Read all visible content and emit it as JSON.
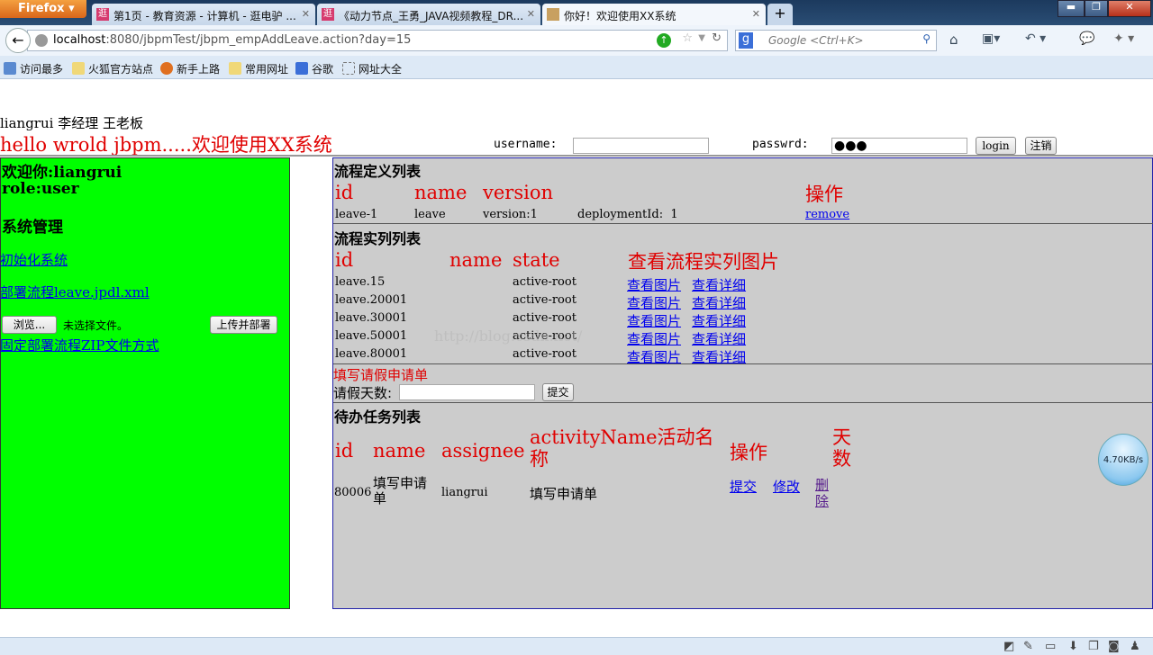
{
  "browser": {
    "menu_label": "Firefox",
    "tabs": [
      {
        "title": "第1页 - 教育资源 - 计算机 - 逛电驴 ...",
        "favicon": "逛"
      },
      {
        "title": "《动力节点_王勇_JAVA视频教程_DR...",
        "favicon": "逛"
      },
      {
        "title": "你好！欢迎使用XX系统",
        "active": true
      }
    ],
    "url_host": "localhost",
    "url_rest": ":8080/jbpmTest/jbpm_empAddLeave.action?day=15",
    "search_placeholder": "Google <Ctrl+K>",
    "bookmarks": [
      "访问最多",
      "火狐官方站点",
      "新手上路",
      "常用网址",
      "谷歌",
      "网址大全"
    ],
    "speed_badge": "4.70KB/s"
  },
  "header": {
    "users": "liangrui 李经理 王老板",
    "title": "hello wrold jbpm.....欢迎使用XX系统",
    "username_label": "username:",
    "username_value": "",
    "password_label": "passwrd:",
    "password_value": "●●●",
    "login": "login",
    "logout": "注销"
  },
  "sidebar": {
    "welcome": "欢迎你:liangrui",
    "role": "role:user",
    "section": "系统管理",
    "init_link": "初始化系统",
    "deploy_link": "部署流程leave.jpdl.xml",
    "browse": "浏览...",
    "no_file": "未选择文件。",
    "upload": "上传并部署",
    "zip_link": "固定部署流程ZIP文件方式"
  },
  "definitions": {
    "title": "流程定义列表",
    "headers": [
      "id",
      "name",
      "version",
      "操作"
    ],
    "rows": [
      {
        "id": "leave-1",
        "name": "leave",
        "version": "version:1",
        "deployment": "deploymentId:  1",
        "action": "remove"
      }
    ]
  },
  "instances": {
    "title": "流程实列列表",
    "headers": [
      "id",
      "name",
      "state",
      "查看流程实列图片"
    ],
    "view_image": "查看图片",
    "view_detail": "查看详细",
    "rows": [
      {
        "id": "leave.15",
        "state": "active-root"
      },
      {
        "id": "leave.20001",
        "state": "active-root"
      },
      {
        "id": "leave.30001",
        "state": "active-root"
      },
      {
        "id": "leave.50001",
        "state": "active-root"
      },
      {
        "id": "leave.80001",
        "state": "active-root"
      }
    ]
  },
  "leave_form": {
    "title": "填写请假申请单",
    "days_label": "请假天数:",
    "days_value": "",
    "submit": "提交"
  },
  "tasks": {
    "title": "待办任务列表",
    "headers": [
      "id",
      "name",
      "assignee",
      "activityName活动名称",
      "操作",
      "天数"
    ],
    "rows": [
      {
        "id": "80006",
        "name": "填写申请单",
        "assignee": "liangrui",
        "activity": "填写申请单",
        "submit": "提交",
        "edit": "修改",
        "delete": "删除"
      }
    ]
  },
  "watermark": "http://blog.csdn.net/"
}
